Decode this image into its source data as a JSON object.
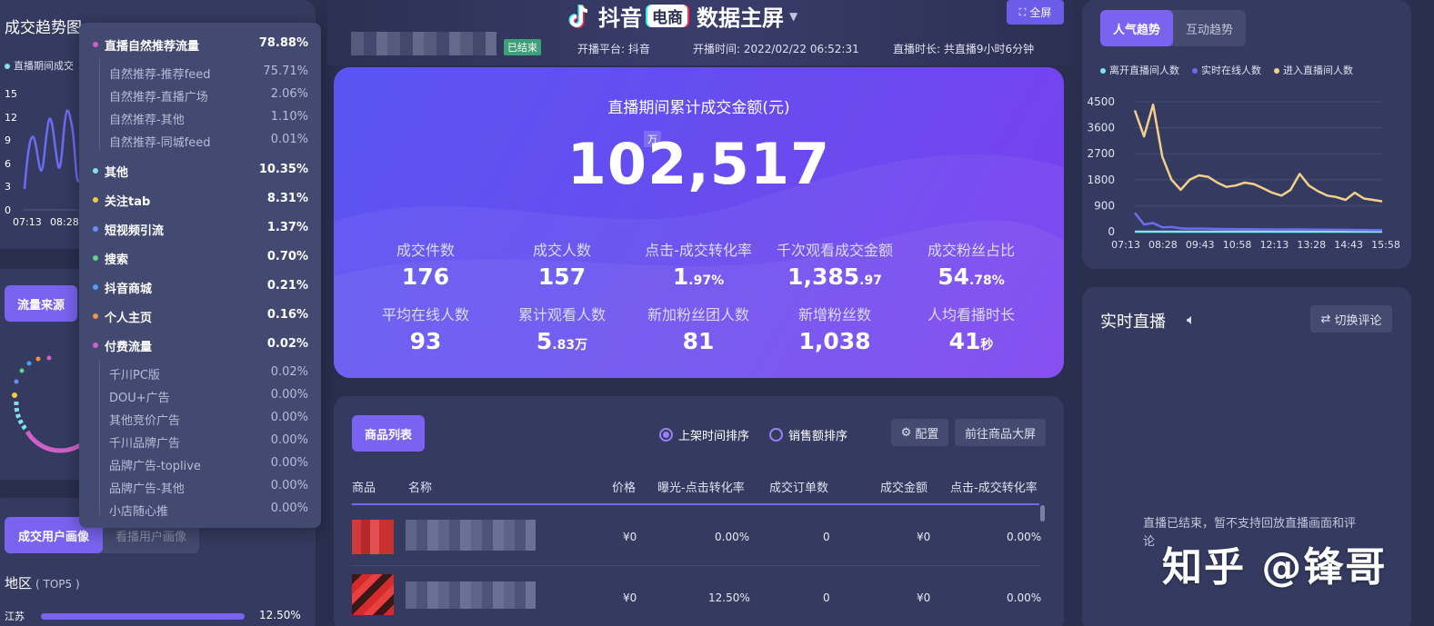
{
  "header": {
    "brand_primary": "抖音",
    "brand_badge": "电商",
    "title": "数据主屏",
    "fullscreen_label": "全屏",
    "status_tag": "已结束",
    "platform": "开播平台: 抖音",
    "start_time": "开播时间: 2022/02/22 06:52:31",
    "duration": "直播时长: 共直播9小时6分钟"
  },
  "hero": {
    "title": "直播期间累计成交金额(元)",
    "amount": "102,517",
    "unit": "万",
    "kpis_row1": [
      {
        "label": "成交件数",
        "value": "176",
        "small": ""
      },
      {
        "label": "成交人数",
        "value": "157",
        "small": ""
      },
      {
        "label": "点击-成交转化率",
        "value": "1",
        "small": ".97%"
      },
      {
        "label": "千次观看成交金额",
        "value": "1,385",
        "small": ".97"
      },
      {
        "label": "成交粉丝占比",
        "value": "54",
        "small": ".78%"
      }
    ],
    "kpis_row2": [
      {
        "label": "平均在线人数",
        "value": "93",
        "small": ""
      },
      {
        "label": "累计观看人数",
        "value": "5",
        "small": ".83万"
      },
      {
        "label": "新加粉丝团人数",
        "value": "81",
        "small": ""
      },
      {
        "label": "新增粉丝数",
        "value": "1,038",
        "small": ""
      },
      {
        "label": "人均看播时长",
        "value": "41",
        "small": "秒"
      }
    ]
  },
  "products": {
    "list_button": "商品列表",
    "sort_options": [
      "上架时间排序",
      "销售额排序"
    ],
    "config_button": "配置",
    "goto_button": "前往商品大屏",
    "columns": [
      "商品",
      "名称",
      "价格",
      "曝光-点击转化率",
      "成交订单数",
      "成交金额",
      "点击-成交转化率"
    ],
    "rows": [
      {
        "price": "¥0",
        "ctr": "0.00%",
        "orders": "0",
        "amount": "¥0",
        "cvr": "0.00%"
      },
      {
        "price": "¥0",
        "ctr": "12.50%",
        "orders": "0",
        "amount": "¥0",
        "cvr": "0.00%"
      }
    ]
  },
  "right": {
    "tabs": [
      "人气趋势",
      "互动趋势"
    ],
    "legend": [
      {
        "label": "离开直播间人数",
        "color": "#7fe3f0"
      },
      {
        "label": "实时在线人数",
        "color": "#6c6cf0"
      },
      {
        "label": "进入直播间人数",
        "color": "#f2cf8a"
      }
    ],
    "live_title": "实时直播",
    "switch_comment": "切换评论",
    "ended_msg": "直播已结束，暂不支持回放直播画面和评论"
  },
  "chart_data": {
    "type": "line",
    "x": [
      "07:13",
      "08:28",
      "09:43",
      "10:58",
      "12:13",
      "13:28",
      "14:43",
      "15:58"
    ],
    "yticks": [
      0,
      900,
      1800,
      2700,
      3600,
      4500
    ],
    "ylim": [
      0,
      4500
    ],
    "series": [
      {
        "name": "进入直播间人数",
        "color": "#f2cf8a",
        "values": [
          4200,
          3300,
          4400,
          2600,
          1800,
          1450,
          1800,
          1950,
          1900,
          1700,
          1550,
          1600,
          1700,
          1650,
          1500,
          1350,
          1250,
          1450,
          2000,
          1600,
          1400,
          1250,
          1200,
          1100,
          1350,
          1150,
          1100,
          1050
        ]
      },
      {
        "name": "实时在线人数",
        "color": "#6c6cf0",
        "values": [
          650,
          250,
          300,
          150,
          160,
          120,
          100,
          110,
          100,
          95,
          90,
          90,
          85,
          85,
          80,
          80,
          75,
          80,
          80,
          75,
          70,
          70,
          65,
          65,
          60,
          60,
          55,
          50
        ]
      },
      {
        "name": "离开直播间人数",
        "color": "#7fe3f0",
        "values": [
          0,
          0,
          0,
          0,
          0,
          0,
          0,
          0,
          0,
          0,
          0,
          0,
          0,
          0,
          0,
          0,
          0,
          0,
          0,
          0,
          0,
          0,
          0,
          0,
          0,
          0,
          0,
          0
        ]
      }
    ]
  },
  "left": {
    "trend_title": "成交趋势图",
    "trend_legend": "直播期间成交",
    "trend_yticks": [
      "15",
      "12",
      "9",
      "6",
      "3",
      "0"
    ],
    "trend_xticks": [
      "07:13",
      "08:28"
    ],
    "traffic_button": "流量来源",
    "profile_tabs": [
      "成交用户画像",
      "看播用户画像"
    ],
    "region_title": "地区",
    "region_sub": "( TOP5 )",
    "region_first": {
      "name": "江苏",
      "value": "12.50%"
    }
  },
  "traffic_popup": [
    {
      "name": "直播自然推荐流量",
      "value": "78.88%",
      "color": "#d060c8",
      "level": 0
    },
    {
      "name": "自然推荐-推荐feed",
      "value": "75.71%",
      "level": 1
    },
    {
      "name": "自然推荐-直播广场",
      "value": "2.06%",
      "level": 1
    },
    {
      "name": "自然推荐-其他",
      "value": "1.10%",
      "level": 1
    },
    {
      "name": "自然推荐-同城feed",
      "value": "0.01%",
      "level": 1
    },
    {
      "name": "其他",
      "value": "10.35%",
      "color": "#7fe3f0",
      "level": 0
    },
    {
      "name": "关注tab",
      "value": "8.31%",
      "color": "#f5c842",
      "level": 0
    },
    {
      "name": "短视频引流",
      "value": "1.37%",
      "color": "#6c8cf5",
      "level": 0
    },
    {
      "name": "搜索",
      "value": "0.70%",
      "color": "#5dd08a",
      "level": 0
    },
    {
      "name": "抖音商城",
      "value": "0.21%",
      "color": "#4aa0f5",
      "level": 0
    },
    {
      "name": "个人主页",
      "value": "0.16%",
      "color": "#f5904a",
      "level": 0
    },
    {
      "name": "付费流量",
      "value": "0.02%",
      "color": "#d060c8",
      "level": 0
    },
    {
      "name": "千川PC版",
      "value": "0.02%",
      "level": 1
    },
    {
      "name": "DOU+广告",
      "value": "0.00%",
      "level": 1
    },
    {
      "name": "其他竞价广告",
      "value": "0.00%",
      "level": 1
    },
    {
      "name": "千川品牌广告",
      "value": "0.00%",
      "level": 1
    },
    {
      "name": "品牌广告-toplive",
      "value": "0.00%",
      "level": 1
    },
    {
      "name": "品牌广告-其他",
      "value": "0.00%",
      "level": 1
    },
    {
      "name": "小店随心推",
      "value": "0.00%",
      "level": 1
    }
  ],
  "watermark": "知乎 @锋哥"
}
